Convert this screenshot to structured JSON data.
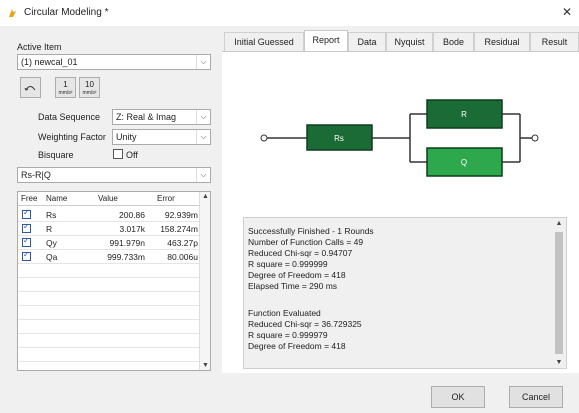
{
  "window": {
    "title": "Circular Modeling *",
    "close": "✕"
  },
  "left": {
    "active_item_label": "Active Item",
    "active_item_value": "(1) newcal_01",
    "icon_buttons": [
      {
        "num": "1",
        "unit": "mm/s²"
      },
      {
        "num": "10",
        "unit": "mm/s²"
      }
    ],
    "data_sequence_label": "Data Sequence",
    "data_sequence_value": "Z: Real & Imag",
    "weighting_label": "Weighting Factor",
    "weighting_value": "Unity",
    "bisquare_label": "Bisquare",
    "bisquare_value": "Off",
    "model_value": "Rs-R|Q",
    "grid": {
      "headers": [
        "Free",
        "Name",
        "Value",
        "Error"
      ],
      "rows": [
        {
          "name": "Rs",
          "value": "200.86",
          "error": "92.939m"
        },
        {
          "name": "R",
          "value": "3.017k",
          "error": "158.274m"
        },
        {
          "name": "Qy",
          "value": "991.979n",
          "error": "463.27p"
        },
        {
          "name": "Qa",
          "value": "999.733m",
          "error": "80.006u"
        }
      ]
    }
  },
  "tabs": [
    "Initial Guessed",
    "Report",
    "Data",
    "Nyquist",
    "Bode",
    "Residual",
    "Result"
  ],
  "circuit": {
    "rs": "Rs",
    "r": "R",
    "q": "Q",
    "colors": {
      "dark": "#1a6b35",
      "light": "#2da84d"
    }
  },
  "report": [
    "Successfully Finished - 1 Rounds",
    "Number of Function Calls = 49",
    "Reduced Chi-sqr = 0.94707",
    "R square = 0.999999",
    "Degree of Freedom = 418",
    "Elapsed Time = 290 ms",
    "",
    "Function Evaluated",
    "Reduced Chi-sqr = 36.729325",
    "R square = 0.999979",
    "Degree of Freedom = 418"
  ],
  "buttons": {
    "ok": "OK",
    "cancel": "Cancel"
  }
}
